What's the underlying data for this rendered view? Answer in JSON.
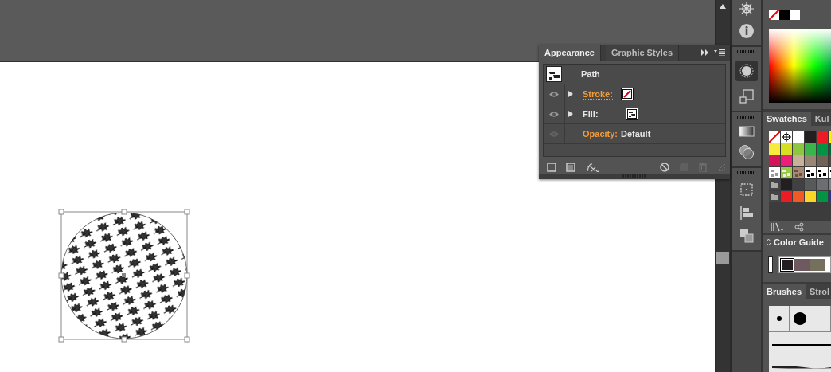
{
  "appearance_panel": {
    "tabs": [
      {
        "label": "Appearance",
        "selected": true
      },
      {
        "label": "Graphic Styles",
        "selected": false
      }
    ],
    "object": "Path",
    "rows": [
      {
        "kind": "stroke",
        "label": "Stroke:",
        "link": true,
        "visible": true,
        "expandable": true
      },
      {
        "kind": "fill",
        "label": "Fill:",
        "link": false,
        "visible": true,
        "expandable": true
      },
      {
        "kind": "opacity",
        "label": "Opacity:",
        "value": "Default",
        "link": true,
        "visible": false,
        "expandable": false
      }
    ]
  },
  "color_panel": {
    "swatches": [
      {
        "kind": "none"
      },
      {
        "kind": "color",
        "color": "#000000"
      },
      {
        "kind": "color",
        "color": "#ffffff"
      }
    ]
  },
  "swatches_panel": {
    "tabs": [
      {
        "label": "Swatches",
        "selected": true
      },
      {
        "label": "Kul",
        "selected": false
      }
    ],
    "rows": [
      [
        {
          "kind": "none"
        },
        {
          "kind": "registration"
        },
        {
          "kind": "color",
          "color": "#ffffff"
        },
        {
          "kind": "color",
          "color": "#231f20"
        },
        {
          "kind": "color",
          "color": "#ed1c24"
        },
        {
          "kind": "color",
          "color": "#fff200"
        }
      ],
      [
        {
          "kind": "color",
          "color": "#f7ec3b"
        },
        {
          "kind": "color",
          "color": "#d7df23"
        },
        {
          "kind": "color",
          "color": "#8dc63f"
        },
        {
          "kind": "color",
          "color": "#39b54a"
        },
        {
          "kind": "color",
          "color": "#009444"
        },
        {
          "kind": "color",
          "color": "#006838"
        }
      ],
      [
        {
          "kind": "color",
          "color": "#d4145a"
        },
        {
          "kind": "color",
          "color": "#ed1e79"
        },
        {
          "kind": "color",
          "color": "#c7b299"
        },
        {
          "kind": "color",
          "color": "#998675"
        },
        {
          "kind": "color",
          "color": "#736357"
        },
        {
          "kind": "color",
          "color": "#534741"
        }
      ],
      [
        {
          "kind": "pattern"
        },
        {
          "kind": "pattern"
        },
        {
          "kind": "pattern"
        },
        {
          "kind": "pattern"
        },
        {
          "kind": "pattern"
        },
        {
          "kind": "pattern"
        }
      ],
      [
        {
          "kind": "folder"
        },
        {
          "kind": "color",
          "color": "#231f20"
        },
        {
          "kind": "color",
          "color": "#414042"
        },
        {
          "kind": "color",
          "color": "#58595b"
        },
        {
          "kind": "color",
          "color": "#6d6e71"
        },
        {
          "kind": "color",
          "color": "#808285"
        }
      ],
      [
        {
          "kind": "folder"
        },
        {
          "kind": "color",
          "color": "#ed1c24"
        },
        {
          "kind": "color",
          "color": "#f15a24"
        },
        {
          "kind": "color",
          "color": "#fbd626"
        },
        {
          "kind": "color",
          "color": "#009444"
        },
        {
          "kind": "color",
          "color": "#2e3192"
        }
      ]
    ]
  },
  "color_guide_panel": {
    "title": "Color Guide",
    "guide": [
      {
        "color": "#231f20"
      },
      {
        "color": "#6e5a5e"
      },
      {
        "color": "#75705e"
      }
    ]
  },
  "brushes_panel": {
    "tabs": [
      {
        "label": "Brushes",
        "selected": true
      },
      {
        "label": "Strol",
        "selected": false
      }
    ]
  }
}
